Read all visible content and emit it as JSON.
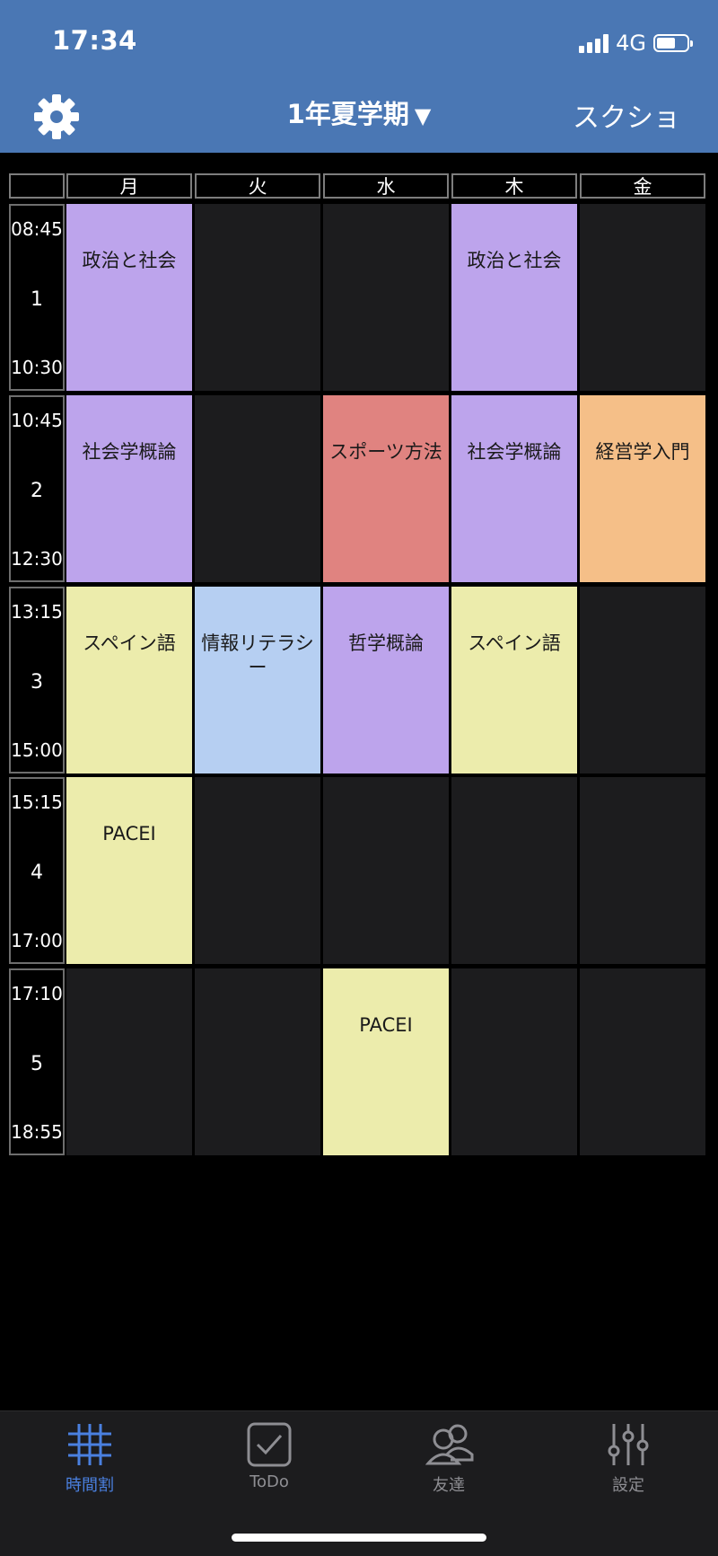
{
  "status": {
    "time": "17:34",
    "network": "4G"
  },
  "nav": {
    "title": "1年夏学期",
    "dropdown_arrow": "▼",
    "screenshot_label": "スクショ",
    "settings_icon": "gear-icon"
  },
  "timetable": {
    "days": [
      "月",
      "火",
      "水",
      "木",
      "金"
    ],
    "periods": [
      {
        "period": "1",
        "start": "08:45",
        "end": "10:30",
        "cells": [
          {
            "course": "政治と社会",
            "color": "purple"
          },
          {
            "course": "",
            "color": "empty"
          },
          {
            "course": "",
            "color": "empty"
          },
          {
            "course": "政治と社会",
            "color": "purple"
          },
          {
            "course": "",
            "color": "empty"
          }
        ]
      },
      {
        "period": "2",
        "start": "10:45",
        "end": "12:30",
        "cells": [
          {
            "course": "社会学概論",
            "color": "purple"
          },
          {
            "course": "",
            "color": "empty"
          },
          {
            "course": "スポーツ方法",
            "color": "red"
          },
          {
            "course": "社会学概論",
            "color": "purple"
          },
          {
            "course": "経営学入門",
            "color": "orange"
          }
        ]
      },
      {
        "period": "3",
        "start": "13:15",
        "end": "15:00",
        "cells": [
          {
            "course": "スペイン語",
            "color": "yellow"
          },
          {
            "course": "情報リテラシー",
            "color": "blue"
          },
          {
            "course": "哲学概論",
            "color": "purple"
          },
          {
            "course": "スペイン語",
            "color": "yellow"
          },
          {
            "course": "",
            "color": "empty"
          }
        ]
      },
      {
        "period": "4",
        "start": "15:15",
        "end": "17:00",
        "cells": [
          {
            "course": "PACEI",
            "color": "yellow"
          },
          {
            "course": "",
            "color": "empty"
          },
          {
            "course": "",
            "color": "empty"
          },
          {
            "course": "",
            "color": "empty"
          },
          {
            "course": "",
            "color": "empty"
          }
        ]
      },
      {
        "period": "5",
        "start": "17:10",
        "end": "18:55",
        "cells": [
          {
            "course": "",
            "color": "empty"
          },
          {
            "course": "",
            "color": "empty"
          },
          {
            "course": "PACEI",
            "color": "yellow"
          },
          {
            "course": "",
            "color": "empty"
          },
          {
            "course": "",
            "color": "empty"
          }
        ]
      }
    ]
  },
  "colors": {
    "header": "#4a77b4",
    "purple": "#bda4ec",
    "red": "#e08380",
    "orange": "#f5bf88",
    "yellow": "#ececac",
    "blue": "#b6cff2",
    "empty": "#1c1c1e",
    "tab_active": "#4a80e0",
    "tab_inactive": "#8e8e93"
  },
  "tabs": [
    {
      "label": "時間割",
      "icon": "grid-icon",
      "active": true
    },
    {
      "label": "ToDo",
      "icon": "checkbox-icon",
      "active": false
    },
    {
      "label": "友達",
      "icon": "people-icon",
      "active": false
    },
    {
      "label": "設定",
      "icon": "sliders-icon",
      "active": false
    }
  ]
}
